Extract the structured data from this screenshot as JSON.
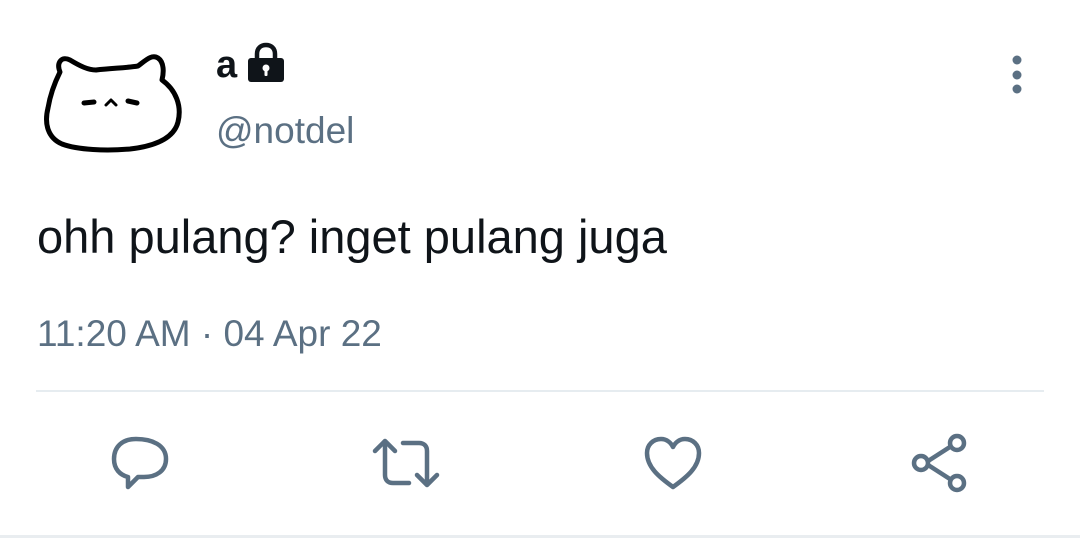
{
  "tweet": {
    "display_name": "a",
    "handle": "@notdel",
    "text": "ohh pulang? inget pulang juga",
    "timestamp": "11:20 AM · 04 Apr 22"
  },
  "icons": {
    "avatar": "cat-face-avatar",
    "protected": "lock-icon",
    "more": "more-vertical-icon",
    "reply": "reply-icon",
    "retweet": "retweet-icon",
    "like": "heart-icon",
    "share": "share-icon"
  },
  "colors": {
    "primary_text": "#0f1419",
    "secondary_text": "#5b7083",
    "icon": "#5b7083",
    "divider": "#e6ecf0"
  }
}
